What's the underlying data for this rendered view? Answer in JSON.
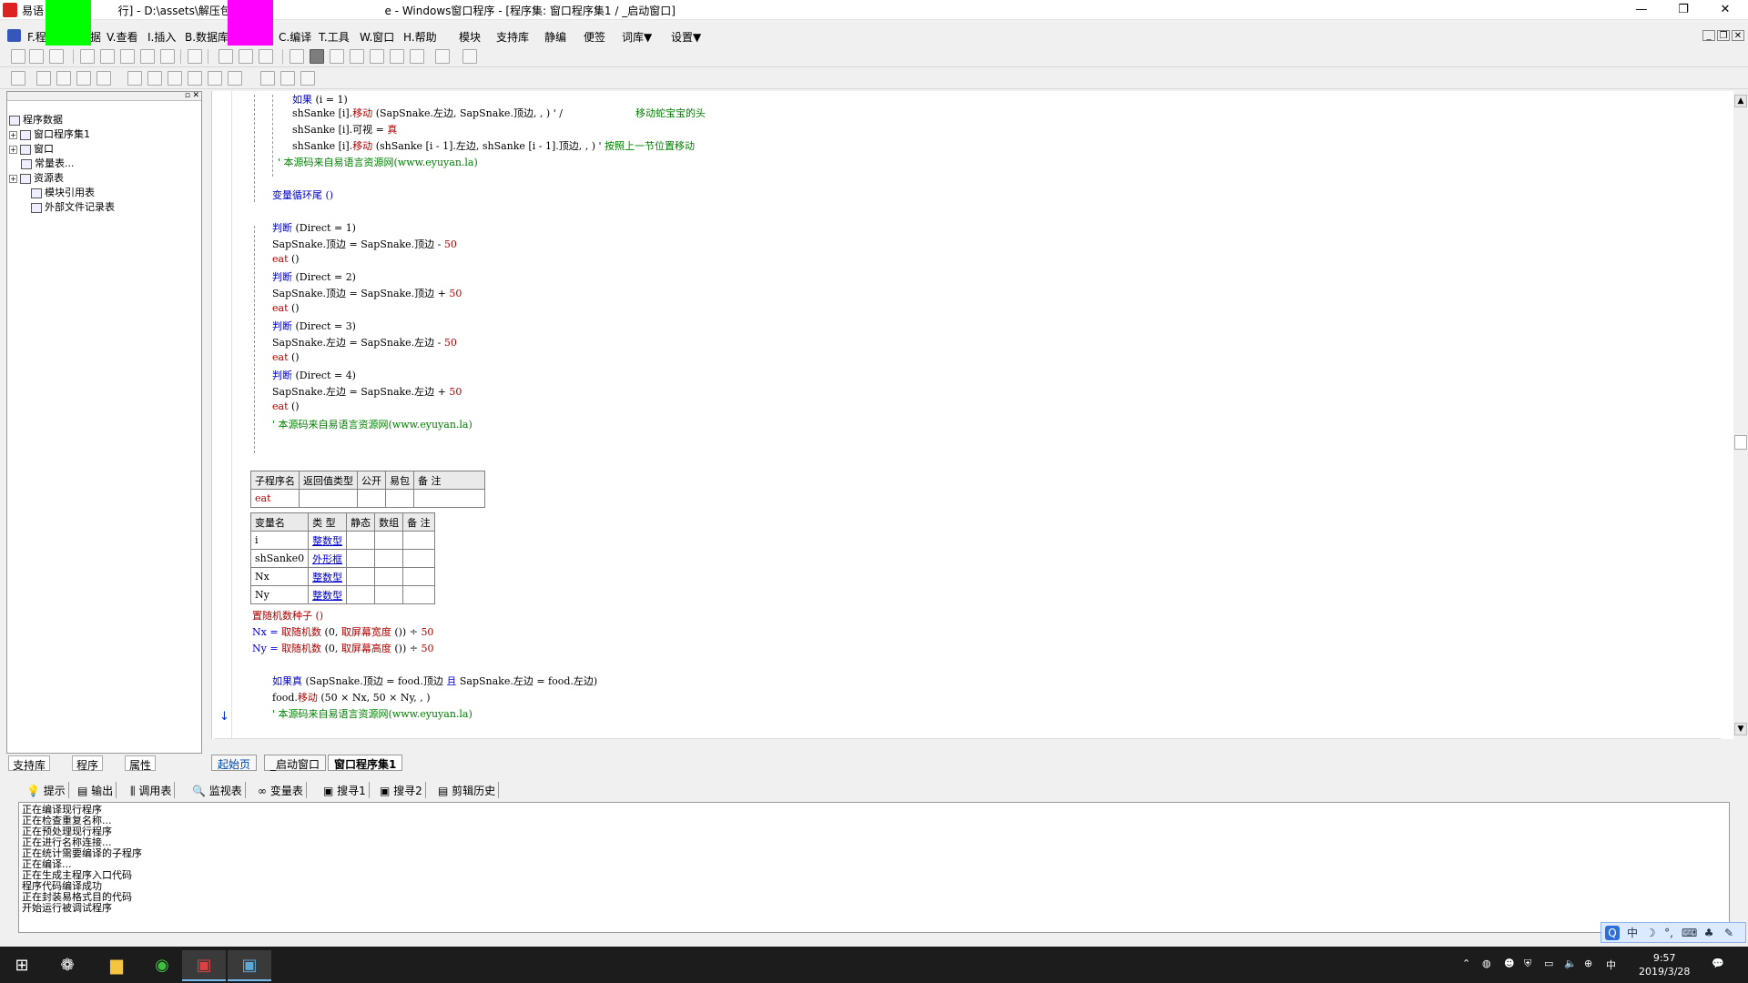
{
  "titlebar": {
    "title": "易语言 - [运行] - D:\\assets\\解压包\\365 ... e - Windows窗口程序 - [程序集: 窗口程序集1 / _启动窗口]",
    "title_left": "易语",
    "title_mid": "行] - D:\\assets\\解压包\\365",
    "title_right": "e - Windows窗口程序 - [程序集: 窗口程序集1 / _启动窗口]",
    "minimize": "—",
    "restore": "❐",
    "close": "✕"
  },
  "menubar": {
    "items": [
      "F.程",
      "据",
      "V.查看",
      "I.插入",
      "B.数据库",
      "C.编译",
      "T.工具",
      "W.窗口",
      "H.帮助",
      "模块",
      "支持库",
      "静编",
      "便签",
      "词库▼",
      "设置▼"
    ],
    "mdi_min": "_",
    "mdi_restore": "❐",
    "mdi_close": "✕"
  },
  "tree": {
    "root": "程序数据",
    "items": [
      "窗口程序集1",
      "窗口",
      "常量表...",
      "资源表",
      "模块引用表",
      "外部文件记录表"
    ]
  },
  "left_tabs": [
    "支持库",
    "程序",
    "属性"
  ],
  "code": {
    "l1": "如果",
    "l1b": "(i = 1)",
    "l2a": "shSanke [i].",
    "l2b": "移动",
    "l2c": "(SapSnake.左边, SapSnake.顶边, , ) ' /",
    "l2d": "移动蛇宝宝的头",
    "l3a": "shSanke [i].可视 =",
    "l3b": "真",
    "l4a": "shSanke [i].",
    "l4b": "移动",
    "l4c": "(shSanke [i - 1].左边, shSanke [i - 1].顶边, , ) '",
    "l4d": "按照上一节位置移动",
    "l5": "' 本源码来自易语言资源网(www.eyuyan.la)",
    "l6": "变量循环尾 ()",
    "j1": "判断",
    "j1b": "(Direct = 1)",
    "j1c": "SapSnake.顶边 = SapSnake.顶边 - ",
    "j1d": "50",
    "eat": "eat",
    "eatp": "()",
    "j2b": "(Direct = 2)",
    "j2c": "SapSnake.顶边 = SapSnake.顶边 + ",
    "j3b": "(Direct = 3)",
    "j3c": "SapSnake.左边 = SapSnake.左边 - ",
    "j4b": "(Direct = 4)",
    "j4c": "SapSnake.左边 = SapSnake.左边 + ",
    "rnd": "置随机数种子 ()",
    "nx1": "Nx = ",
    "nx2": "取随机数",
    "nx3": "(0, ",
    "nx4": "取屏幕宽度",
    "nx5": "()) ÷ ",
    "ny1": "Ny = ",
    "ny4": "取屏幕高度",
    "ifz": "如果真",
    "ifz2": "(SapSnake.顶边 = food.顶边",
    "ifz3": "且",
    "ifz4": "SapSnake.左边 = food.左边)",
    "fm1": "food.",
    "fm2": "移动",
    "fm3": "(50 × Nx, 50 × Ny, , )"
  },
  "sub_table": {
    "headers": [
      "子程序名",
      "返回值类型",
      "公开",
      "易包",
      "备 注"
    ],
    "row": [
      "eat",
      "",
      "",
      "",
      ""
    ]
  },
  "var_table": {
    "headers": [
      "变量名",
      "类 型",
      "静态",
      "数组",
      "备 注"
    ],
    "rows": [
      [
        "i",
        "整数型",
        "",
        "",
        ""
      ],
      [
        "shSanke0",
        "外形框",
        "",
        "",
        ""
      ],
      [
        "Nx",
        "整数型",
        "",
        "",
        ""
      ],
      [
        "Ny",
        "整数型",
        "",
        "",
        ""
      ]
    ]
  },
  "editor_tabs": [
    "起始页",
    "_启动窗口",
    "窗口程序集1"
  ],
  "bottom_tabs": [
    "提示",
    "输出",
    "调用表",
    "监视表",
    "变量表",
    "搜寻1",
    "搜寻2",
    "剪辑历史"
  ],
  "output_lines": [
    "正在编译现行程序",
    "正在检查重复名称...",
    "正在预处理现行程序",
    "正在进行名称连接...",
    "正在统计需要编译的子程序",
    "正在编译...",
    "正在生成主程序入口代码",
    "程序代码编译成功",
    "正在封装易格式目的代码",
    "开始运行被调试程序"
  ],
  "ime": [
    "中",
    "☽",
    "°,",
    "⌨",
    "♣",
    "✎"
  ],
  "taskbar": {
    "time": "9:57",
    "date": "2019/3/28",
    "ime_label": "中"
  }
}
